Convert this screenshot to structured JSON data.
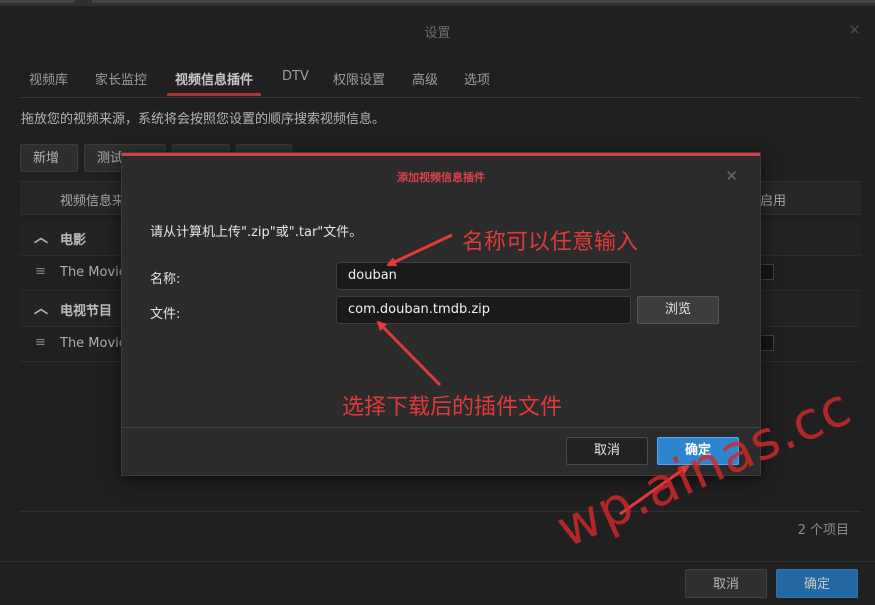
{
  "settings_dialog": {
    "title": "设置",
    "tabs": [
      "视频库",
      "家长监控",
      "视频信息插件",
      "DTV",
      "权限设置",
      "高级",
      "选项"
    ],
    "active_tab": "视频信息插件",
    "description": "拖放您的视频来源，系统将会按照您设置的顺序搜索视频信息。",
    "toolbar": {
      "add_label": "新增",
      "test_label": "测试"
    },
    "table": {
      "col_name": "视频信息来",
      "col_enable": "启用",
      "groups": [
        {
          "label": "电影",
          "item": "The Movie"
        },
        {
          "label": "电视节目",
          "item": "The Movie"
        }
      ],
      "count": "2 个项目"
    },
    "footer": {
      "cancel_label": "取消",
      "ok_label": "确定"
    }
  },
  "modal": {
    "title": "添加视频信息插件",
    "hint": "请从计算机上传\".zip\"或\".tar\"文件。",
    "name_label": "名称:",
    "name_value": "douban",
    "file_label": "文件:",
    "file_value": "com.douban.tmdb.zip",
    "browse_label": "浏览",
    "cancel_label": "取消",
    "ok_label": "确定"
  },
  "annotations": {
    "name_note": "名称可以任意输入",
    "file_note": "选择下载后的插件文件",
    "color": "#e03a3a"
  },
  "watermark": "wp.ainas.cc",
  "colors": {
    "accent_red": "#d24149",
    "primary_blue": "#2e86d0"
  },
  "icons": {
    "close": "close-icon",
    "collapse": "chevron-up-icon",
    "drag": "drag-handle-icon"
  }
}
